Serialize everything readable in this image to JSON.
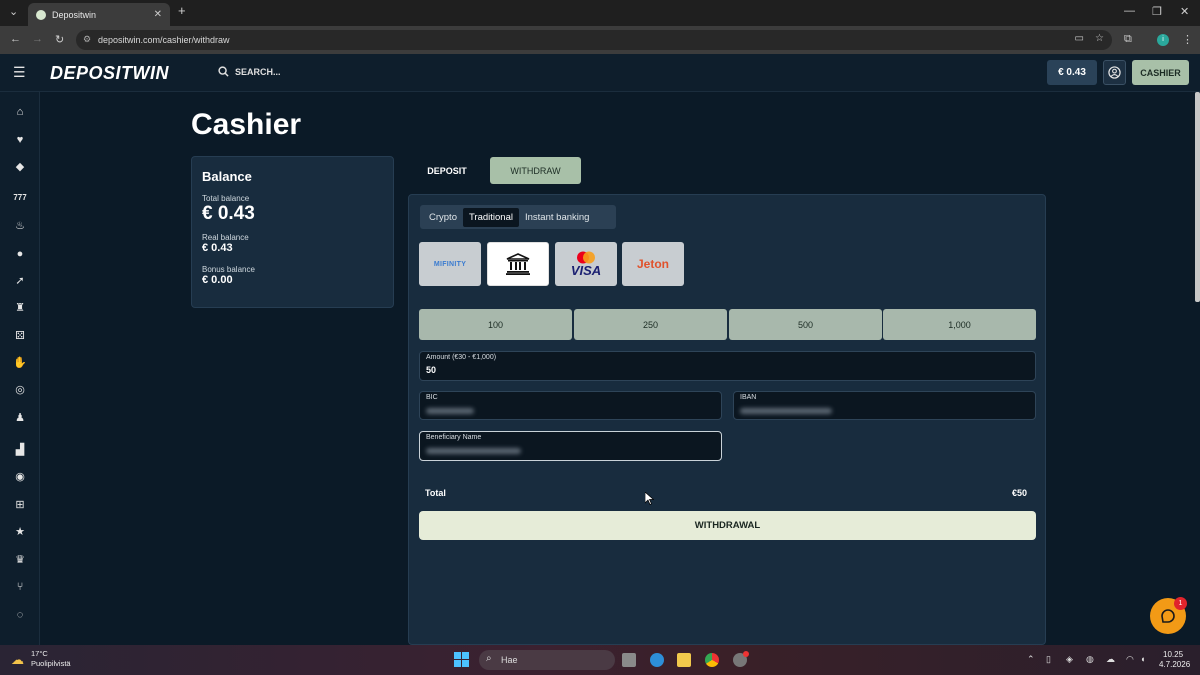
{
  "browser": {
    "tab_title": "Depositwin",
    "url": "depositwin.com/cashier/withdraw",
    "tab_close": "✕",
    "new_tab": "+"
  },
  "header": {
    "logo": "DEPOSITWIN",
    "search_label": "SEARCH...",
    "balance": "€ 0.43",
    "cashier_label": "CASHIER"
  },
  "sidebar": {
    "icons": [
      "home-icon",
      "heart-icon",
      "diamond-icon",
      "777-icon",
      "flame-icon",
      "live-casino-icon",
      "rocket-icon",
      "joystick-icon",
      "dice-icon",
      "hand-icon",
      "globe-icon",
      "trophy-icon",
      "podium-icon",
      "target-icon",
      "gift-icon",
      "star-icon",
      "crown-icon",
      "affiliate-icon",
      "chat-icon"
    ]
  },
  "page": {
    "title": "Cashier"
  },
  "balance_card": {
    "heading": "Balance",
    "total_label": "Total balance",
    "total_value": "€ 0.43",
    "real_label": "Real balance",
    "real_value": "€ 0.43",
    "bonus_label": "Bonus balance",
    "bonus_value": "€ 0.00"
  },
  "tabs": {
    "deposit": "DEPOSIT",
    "withdraw": "WITHDRAW",
    "active": "WITHDRAW"
  },
  "method_tabs": [
    "Crypto",
    "Traditional",
    "Instant banking"
  ],
  "active_method": "Traditional",
  "payment_methods": [
    {
      "name": "MIFINITY",
      "icon": "mifinity-logo"
    },
    {
      "name": "bank",
      "icon": "bank-icon"
    },
    {
      "name": "VISA",
      "icon": "visa-mastercard-logo"
    },
    {
      "name": "Jeton",
      "icon": "jeton-logo"
    }
  ],
  "quick_amounts": [
    "100",
    "250",
    "500",
    "1,000"
  ],
  "form": {
    "amount_label": "Amount (€30 - €1,000)",
    "amount_value": "50",
    "bic_label": "BIC",
    "iban_label": "IBAN",
    "beneficiary_label": "Beneficiary Name"
  },
  "total": {
    "label": "Total",
    "value": "€50"
  },
  "submit_label": "WITHDRAWAL",
  "chat_badge": "1",
  "taskbar": {
    "weather_temp": "17°C",
    "weather_text": "Puolipilvistä",
    "search_placeholder": "Hae",
    "time": "10.25",
    "date": "4.7.2026"
  },
  "colors": {
    "background": "#0b1a27",
    "panel": "#182c3e",
    "accent_green": "#a8c0a8",
    "submit_bg": "#e6ecd8",
    "chat_orange": "#f29a16"
  }
}
